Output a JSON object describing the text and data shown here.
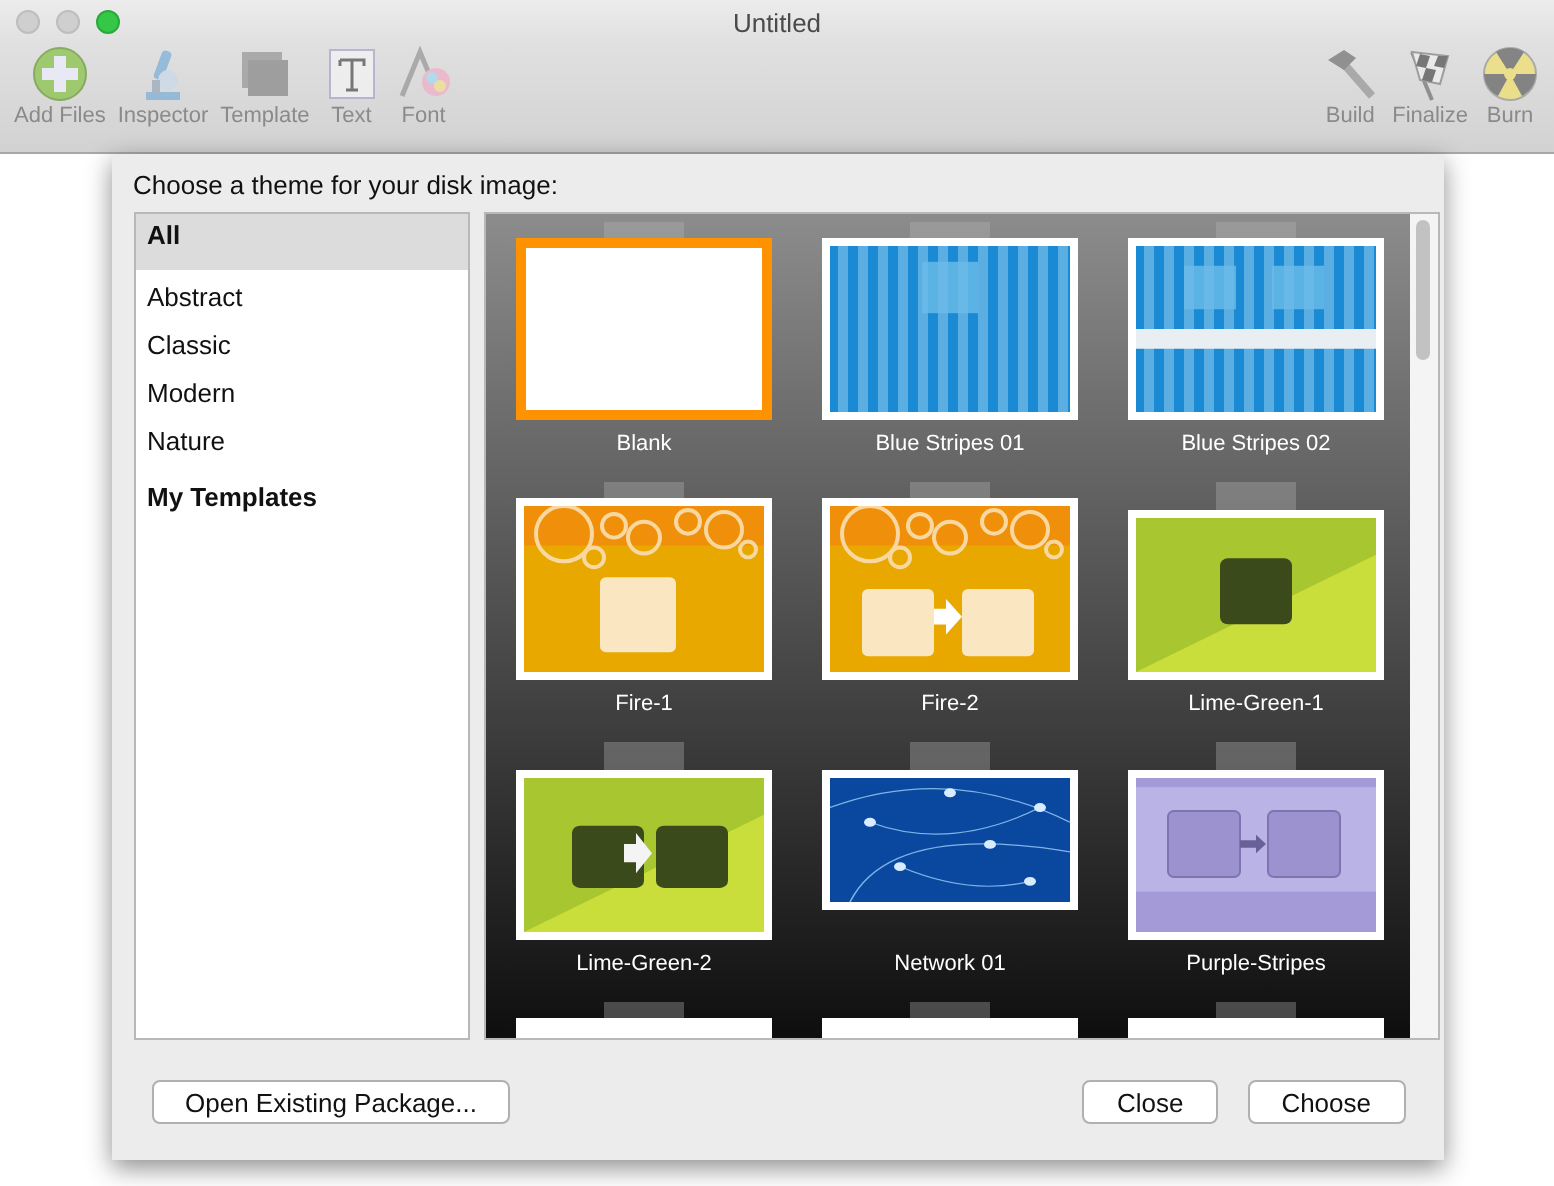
{
  "window": {
    "title": "Untitled"
  },
  "toolbar": {
    "left": [
      {
        "label": "Add Files",
        "kind": "add"
      },
      {
        "label": "Inspector",
        "kind": "microscope"
      },
      {
        "label": "Template",
        "kind": "template"
      },
      {
        "label": "Text",
        "kind": "text"
      },
      {
        "label": "Font",
        "kind": "font"
      }
    ],
    "right": [
      {
        "label": "Build",
        "kind": "hammer"
      },
      {
        "label": "Finalize",
        "kind": "flag"
      },
      {
        "label": "Burn",
        "kind": "burn"
      }
    ]
  },
  "dialog": {
    "prompt": "Choose a theme for your disk image:",
    "categories": [
      {
        "label": "All",
        "kind": "item",
        "selected": true
      },
      {
        "label": "Abstract",
        "kind": "item",
        "selected": false
      },
      {
        "label": "Classic",
        "kind": "item",
        "selected": false
      },
      {
        "label": "Modern",
        "kind": "item",
        "selected": false
      },
      {
        "label": "Nature",
        "kind": "item",
        "selected": false
      },
      {
        "label": "My Templates",
        "kind": "heading",
        "selected": false
      }
    ],
    "themes": [
      {
        "label": "Blank",
        "kind": "blank",
        "selected": true
      },
      {
        "label": "Blue Stripes 01",
        "kind": "stripes1",
        "selected": false
      },
      {
        "label": "Blue Stripes 02",
        "kind": "stripes2",
        "selected": false
      },
      {
        "label": "Fire-1",
        "kind": "fire1",
        "selected": false
      },
      {
        "label": "Fire-2",
        "kind": "fire2",
        "selected": false
      },
      {
        "label": "Lime-Green-1",
        "kind": "lime1",
        "selected": false
      },
      {
        "label": "Lime-Green-2",
        "kind": "lime2",
        "selected": false
      },
      {
        "label": "Network 01",
        "kind": "network",
        "selected": false
      },
      {
        "label": "Purple-Stripes",
        "kind": "purple",
        "selected": false
      },
      {
        "kind": "cut",
        "selected": false
      },
      {
        "kind": "cut",
        "selected": false
      },
      {
        "kind": "cut",
        "selected": false
      }
    ],
    "buttons": [
      {
        "label": "Open Existing Package...",
        "kind": "left"
      },
      {
        "label": "Close",
        "kind": "right"
      },
      {
        "label": "Choose",
        "kind": "right"
      }
    ]
  }
}
